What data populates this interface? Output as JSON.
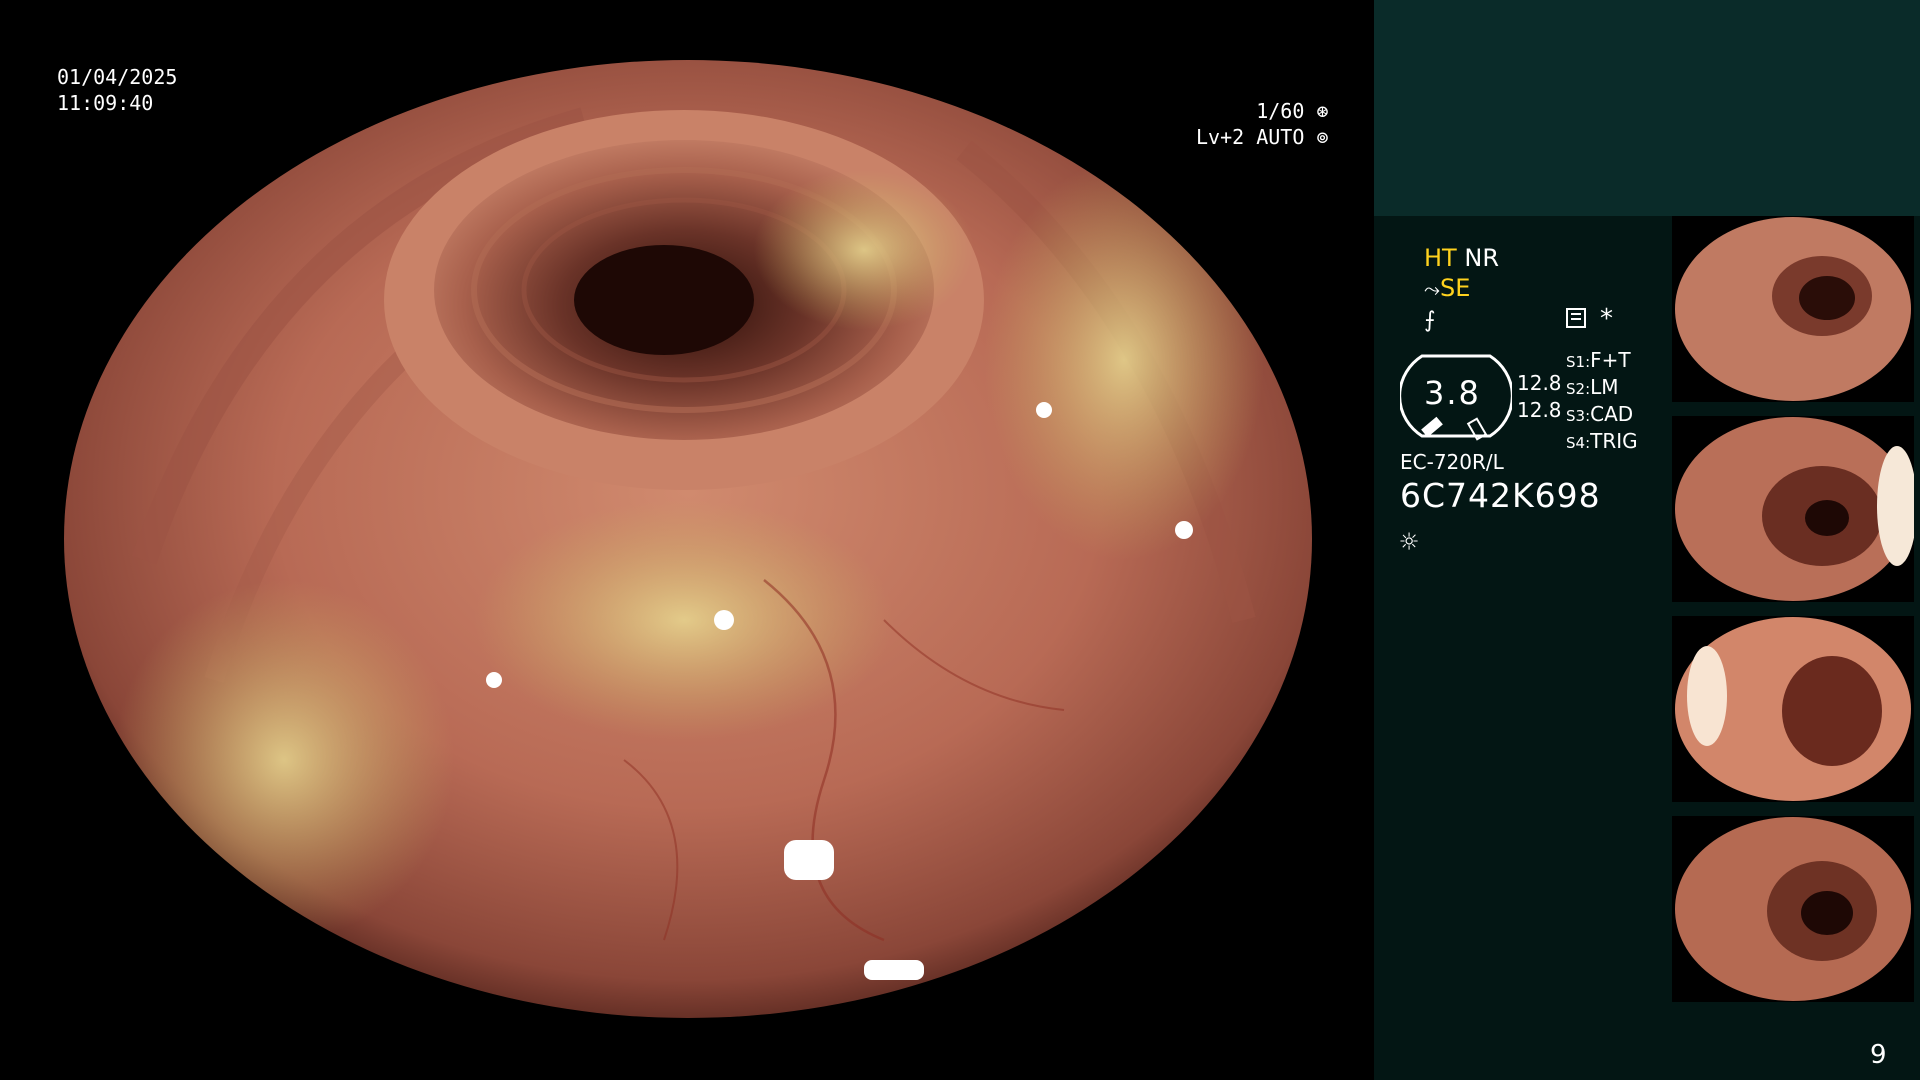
{
  "main_view": {
    "date": "01/04/2025",
    "time": "11:09:40",
    "shutter": "1/60",
    "level": "Lv+2",
    "mode": "AUTO"
  },
  "side_panel": {
    "ht": "HT",
    "nr": "NR",
    "se": "SE",
    "gauge_value": "3.8",
    "gauge_side_top": "12.8",
    "gauge_side_bottom": "12.8",
    "s1_key": "S1:",
    "s1_val": "F+T",
    "s2_key": "S2:",
    "s2_val": "LM",
    "s3_key": "S3:",
    "s3_val": "CAD",
    "s4_key": "S4:",
    "s4_val": "TRIG",
    "asterisk": "*",
    "scope_model": "EC-720R/L",
    "serial": "6C742K698",
    "page_number": "9"
  },
  "colors": {
    "accent_yellow": "#ffd21e",
    "panel_bg": "#031614",
    "panel_top_bg": "#0a2b29"
  },
  "icons": [
    "shutter-icon",
    "auto-iris-icon",
    "hook-icon",
    "filter-icon",
    "menu-card-icon",
    "light-icon"
  ]
}
